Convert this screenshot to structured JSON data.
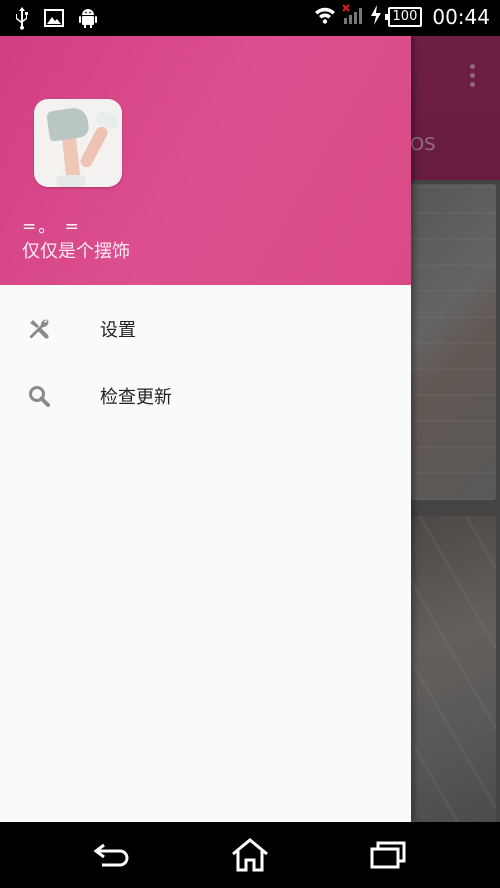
{
  "status_bar": {
    "time": "00:44",
    "battery": "100",
    "icons": [
      "usb-icon",
      "image-icon",
      "android-icon",
      "wifi-icon",
      "signal-icon",
      "charging-icon",
      "battery-icon"
    ]
  },
  "background_app": {
    "tab_fragment": "OS"
  },
  "drawer": {
    "user": {
      "nickname": "=。 =",
      "signature": "仅仅是个摆饰"
    },
    "menu": [
      {
        "icon": "wrench-icon",
        "label": "设置"
      },
      {
        "icon": "search-icon",
        "label": "检查更新"
      }
    ]
  },
  "colors": {
    "header_pink": "#d94a86",
    "drawer_bg": "#fafafa",
    "icon_gray": "#8a8a8a"
  },
  "nav_bar": {
    "buttons": [
      "back-icon",
      "home-icon",
      "recent-apps-icon"
    ]
  }
}
